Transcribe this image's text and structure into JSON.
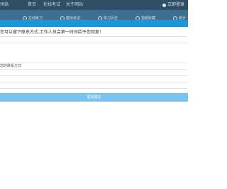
{
  "header": {
    "brand": "州站",
    "nav": [
      "首页",
      "在线考试",
      "关于网站"
    ],
    "login": "立即登录"
  },
  "subnav": [
    "在线练习",
    "模拟考试",
    "练习历史",
    "错题收藏",
    "统计"
  ],
  "content": {
    "prompt": "您可以留下联系方式,工作人员会第一时间给予您回复！",
    "contact_label": "您的联系方式"
  },
  "actions": {
    "submit": "提交留言"
  },
  "colors": {
    "topbar": "#2f4f66",
    "subbar": "#3f6f90",
    "accent": "#1e95d6",
    "submit": "#78c4ee"
  }
}
